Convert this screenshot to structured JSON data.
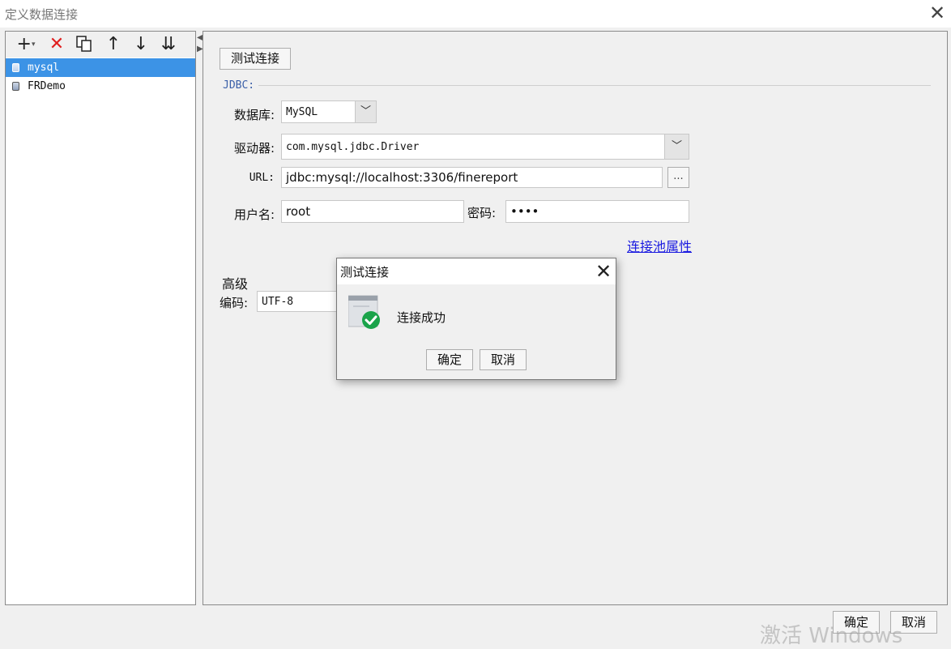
{
  "window": {
    "title": "定义数据连接",
    "close_icon": "close-icon"
  },
  "toolbar": {
    "add_icon": "plus-icon",
    "delete_icon": "red-x-icon",
    "copy_icon": "copy-icon",
    "up_icon": "arrow-up-icon",
    "down_icon": "arrow-down-icon",
    "sort_icon": "sort-icon",
    "delete_color": "#e02020"
  },
  "connections": [
    {
      "name": "mysql",
      "selected": true
    },
    {
      "name": "FRDemo",
      "selected": false
    }
  ],
  "form": {
    "test_button": "测试连接",
    "jdbc_legend": "JDBC:",
    "database_label": "数据库:",
    "database_value": "MySQL",
    "driver_label": "驱动器:",
    "driver_value": "com.mysql.jdbc.Driver",
    "url_label": "URL:",
    "url_value": "jdbc:mysql://localhost:3306/finereport",
    "url_browse": "...",
    "username_label": "用户名:",
    "username_value": "root",
    "password_label": "密码:",
    "password_value": "••••",
    "pool_link": "连接池属性",
    "advanced_label": "高级",
    "encoding_label": "编码:",
    "encoding_value": "UTF-8"
  },
  "dialog": {
    "title": "测试连接",
    "message": "连接成功",
    "ok": "确定",
    "cancel": "取消",
    "success_color": "#1aa34a"
  },
  "footer": {
    "ok": "确定",
    "cancel": "取消"
  },
  "watermark": "激活 Windows"
}
